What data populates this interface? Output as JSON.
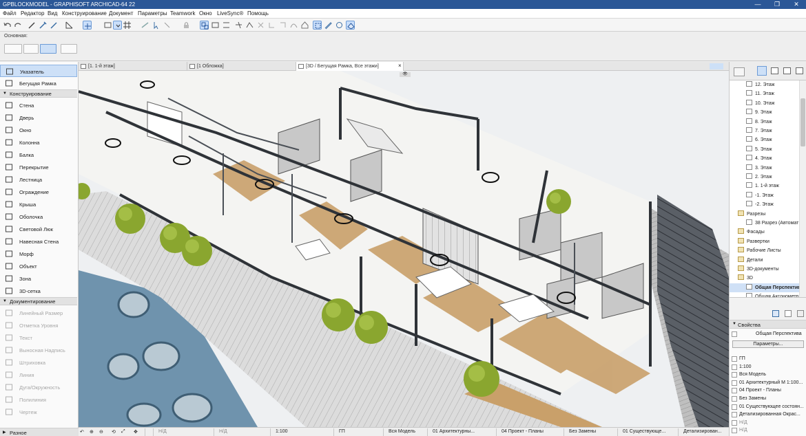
{
  "window": {
    "title": "GPBLOCKMODEL - GRAPHISOFT ARCHICAD-64 22",
    "controls": [
      "—",
      "❐",
      "✕"
    ]
  },
  "menu": [
    "Файл",
    "Редактор",
    "Вид",
    "Конструирование",
    "Документ",
    "Параметры",
    "Teamwork",
    "Окно",
    "LiveSync®",
    "Помощь"
  ],
  "infobox": {
    "label": "Основная:"
  },
  "toolbox": {
    "top_tools": [
      "Указатель",
      "Бегущая Рамка"
    ],
    "groups": [
      {
        "name": "Конструирование",
        "tools": [
          "Стена",
          "Дверь",
          "Окно",
          "Колонна",
          "Балка",
          "Перекрытие",
          "Лестница",
          "Ограждение",
          "Крыша",
          "Оболочка",
          "Световой Люк",
          "Навесная Стена",
          "Морф",
          "Объект",
          "Зона",
          "3D-сетка"
        ]
      },
      {
        "name": "Документирование",
        "tools": [
          "Линейный Размер",
          "Отметка Уровня",
          "Текст",
          "Выносная Надпись",
          "Штриховка",
          "Линия",
          "Дуга/Окружность",
          "Полилиния",
          "Чертеж"
        ]
      }
    ],
    "bottom_group": "Разное"
  },
  "tabs": [
    {
      "label": "[1. 1-й этаж]",
      "active": false
    },
    {
      "label": "[1 Обложка]",
      "active": false
    },
    {
      "label": "[3D / Бегущая Рамка, Все этажи]",
      "active": true
    }
  ],
  "tab_close": "×",
  "navigator": {
    "items": [
      {
        "label": "12. Этаж",
        "indent": 2,
        "icon": "story"
      },
      {
        "label": "11. Этаж",
        "indent": 2,
        "icon": "story"
      },
      {
        "label": "10. Этаж",
        "indent": 2,
        "icon": "story"
      },
      {
        "label": "9. Этаж",
        "indent": 2,
        "icon": "story"
      },
      {
        "label": "8. Этаж",
        "indent": 2,
        "icon": "story"
      },
      {
        "label": "7. Этаж",
        "indent": 2,
        "icon": "story"
      },
      {
        "label": "6. Этаж",
        "indent": 2,
        "icon": "story"
      },
      {
        "label": "5. Этаж",
        "indent": 2,
        "icon": "story"
      },
      {
        "label": "4. Этаж",
        "indent": 2,
        "icon": "story"
      },
      {
        "label": "3. Этаж",
        "indent": 2,
        "icon": "story"
      },
      {
        "label": "2. Этаж",
        "indent": 2,
        "icon": "story"
      },
      {
        "label": "1. 1-й этаж",
        "indent": 2,
        "icon": "story"
      },
      {
        "label": "-1. Этаж",
        "indent": 2,
        "icon": "story"
      },
      {
        "label": "-2. Этаж",
        "indent": 2,
        "icon": "story"
      },
      {
        "label": "Разрезы",
        "indent": 1,
        "icon": "folder"
      },
      {
        "label": "38 Разрез (Автомат",
        "indent": 2,
        "icon": "section"
      },
      {
        "label": "Фасады",
        "indent": 1,
        "icon": "folder"
      },
      {
        "label": "Развертки",
        "indent": 1,
        "icon": "folder"
      },
      {
        "label": "Рабочие Листы",
        "indent": 1,
        "icon": "folder"
      },
      {
        "label": "Детали",
        "indent": 1,
        "icon": "folder"
      },
      {
        "label": "3D-документы",
        "indent": 1,
        "icon": "folder"
      },
      {
        "label": "3D",
        "indent": 1,
        "icon": "folder"
      },
      {
        "label": "Общая Перспектива",
        "indent": 2,
        "icon": "view",
        "selected": true
      },
      {
        "label": "Общая Аксонометр",
        "indent": 2,
        "icon": "view"
      }
    ]
  },
  "properties": {
    "header": "Свойства",
    "name": "Общая Перспектива",
    "button": "Параметры...",
    "rows": [
      {
        "label": "ГП",
        "dim": false
      },
      {
        "label": "1:100",
        "dim": false
      },
      {
        "label": "Вся Модель",
        "dim": false
      },
      {
        "label": "01 Архитектурный М 1:100...",
        "dim": false
      },
      {
        "label": "04 Проект - Планы",
        "dim": false
      },
      {
        "label": "Без Замены",
        "dim": false
      },
      {
        "label": "01 Существующее состоян...",
        "dim": false
      },
      {
        "label": "Детализированная Окрас...",
        "dim": false
      },
      {
        "label": "Н/Д",
        "dim": true
      },
      {
        "label": "Н/Д",
        "dim": true
      }
    ]
  },
  "statusbar": {
    "items": [
      "Н/Д",
      "Н/Д",
      "1:100",
      "ГП",
      "Вся Модель",
      "01 Архитектурны...",
      "04 Проект - Планы",
      "Без Замены",
      "01 Существующе...",
      "Детализирован..."
    ]
  },
  "colors": {
    "titlebar": "#2b5797",
    "selection": "#cde0f7",
    "facade_blue": "#6f93ad",
    "floor_wood": "#c9a06a",
    "plant_green": "#8aa62f"
  }
}
